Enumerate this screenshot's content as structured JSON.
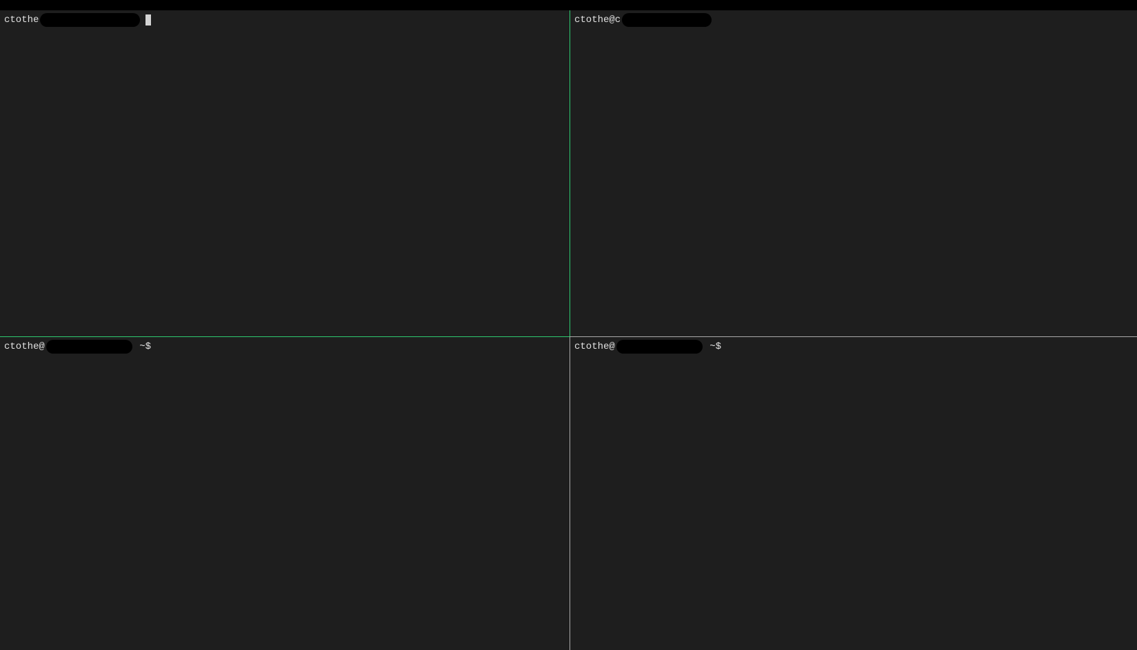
{
  "panes": {
    "pane1": {
      "prompt_prefix": "ctothe",
      "has_cursor": true,
      "prompt_suffix": ""
    },
    "pane2": {
      "prompt_prefix": "ctothe@c",
      "has_cursor": false,
      "prompt_suffix": ""
    },
    "pane3": {
      "prompt_prefix": "ctothe@",
      "has_cursor": false,
      "prompt_suffix": " ~$"
    },
    "pane4": {
      "prompt_prefix": "ctothe@",
      "has_cursor": false,
      "prompt_suffix": " ~$"
    }
  },
  "colors": {
    "active_border": "#2ecc71",
    "inactive_border": "#aaa",
    "background": "#1e1e1e",
    "text": "#d4d4d4"
  }
}
